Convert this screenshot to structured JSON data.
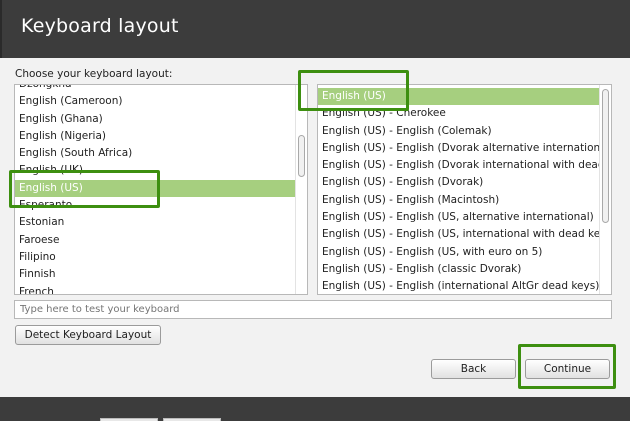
{
  "window": {
    "title": "Keyboard layout"
  },
  "prompt": "Choose your keyboard layout:",
  "layouts": [
    "Dzongkha",
    "English (Cameroon)",
    "English (Ghana)",
    "English (Nigeria)",
    "English (South Africa)",
    "English (UK)",
    "English (US)",
    "Esperanto",
    "Estonian",
    "Faroese",
    "Filipino",
    "Finnish",
    "French"
  ],
  "selected_layout": "English (US)",
  "variants": [
    "English (US)",
    "English (US) - Cherokee",
    "English (US) - English (Colemak)",
    "English (US) - English (Dvorak alternative international",
    "English (US) - English (Dvorak international with dead k",
    "English (US) - English (Dvorak)",
    "English (US) - English (Macintosh)",
    "English (US) - English (US, alternative international)",
    "English (US) - English (US, international with dead keys",
    "English (US) - English (US, with euro on 5)",
    "English (US) - English (classic Dvorak)",
    "English (US) - English (international AltGr dead keys)"
  ],
  "selected_variant": "English (US)",
  "test_input": {
    "value": "",
    "placeholder": "Type here to test your keyboard"
  },
  "buttons": {
    "detect": "Detect Keyboard Layout",
    "back": "Back",
    "continue": "Continue"
  },
  "highlight_color": "#3d8f10",
  "selection_color": "#a6cf7f"
}
